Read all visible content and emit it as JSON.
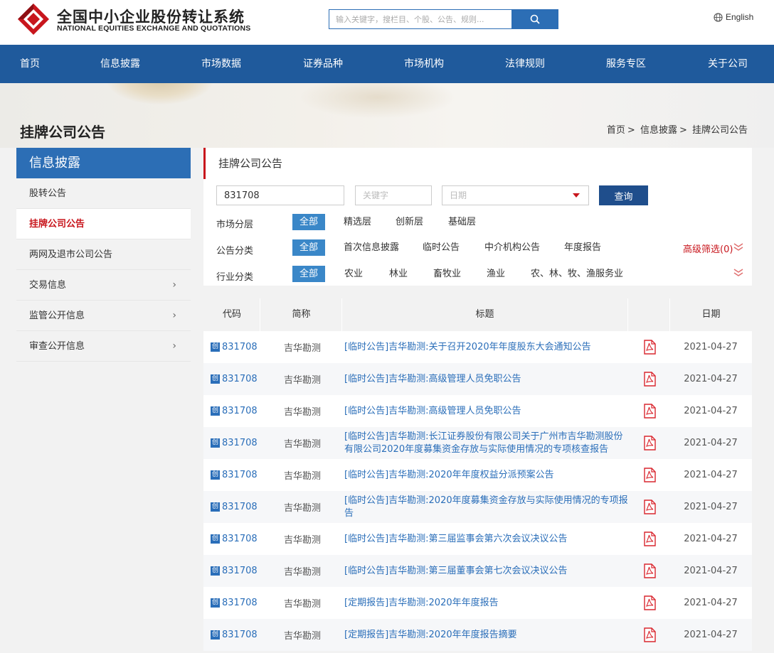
{
  "header": {
    "logo_cn": "全国中小企业股份转让系统",
    "logo_en": "NATIONAL EQUITIES EXCHANGE AND QUOTATIONS",
    "search_placeholder": "输入关键字，搜栏目、个股、公告、规则...",
    "lang": "English"
  },
  "nav": [
    "首页",
    "信息披露",
    "市场数据",
    "证券品种",
    "市场机构",
    "法律规则",
    "服务专区",
    "关于公司"
  ],
  "banner": {
    "page_title": "挂牌公司公告",
    "breadcrumb": [
      "首页",
      "信息披露",
      "挂牌公司公告"
    ]
  },
  "sidebar": {
    "title": "信息披露",
    "items": [
      {
        "label": "股转公告",
        "active": false,
        "expandable": false
      },
      {
        "label": "挂牌公司公告",
        "active": true,
        "expandable": false
      },
      {
        "label": "两网及退市公司公告",
        "active": false,
        "expandable": false
      },
      {
        "label": "交易信息",
        "active": false,
        "expandable": true
      },
      {
        "label": "监管公开信息",
        "active": false,
        "expandable": true
      },
      {
        "label": "审查公开信息",
        "active": false,
        "expandable": true
      }
    ]
  },
  "filter": {
    "title": "挂牌公司公告",
    "code_value": "831708",
    "keyword_placeholder": "关键字",
    "date_placeholder": "日期",
    "query_label": "查询",
    "market_label": "市场分层",
    "market_options": [
      "全部",
      "精选层",
      "创新层",
      "基础层"
    ],
    "category_label": "公告分类",
    "category_options": [
      "全部",
      "首次信息披露",
      "临时公告",
      "中介机构公告",
      "年度报告"
    ],
    "advanced_label": "高级筛选(0)",
    "industry_label": "行业分类",
    "industry_options": [
      "全部",
      "农业",
      "林业",
      "畜牧业",
      "渔业",
      "农、林、牧、渔服务业"
    ]
  },
  "table": {
    "headers": [
      "代码",
      "简称",
      "标题",
      "",
      "日期"
    ],
    "badge": "创",
    "rows": [
      {
        "code": "831708",
        "name": "吉华勘测",
        "title": "[临时公告]吉华勘测:关于召开2020年年度股东大会通知公告",
        "date": "2021-04-27"
      },
      {
        "code": "831708",
        "name": "吉华勘测",
        "title": "[临时公告]吉华勘测:高级管理人员免职公告",
        "date": "2021-04-27"
      },
      {
        "code": "831708",
        "name": "吉华勘测",
        "title": "[临时公告]吉华勘测:高级管理人员免职公告",
        "date": "2021-04-27"
      },
      {
        "code": "831708",
        "name": "吉华勘测",
        "title": "[临时公告]吉华勘测:长江证券股份有限公司关于广州市吉华勘测股份有限公司2020年度募集资金存放与实际使用情况的专项核查报告",
        "date": "2021-04-27"
      },
      {
        "code": "831708",
        "name": "吉华勘测",
        "title": "[临时公告]吉华勘测:2020年年度权益分派预案公告",
        "date": "2021-04-27"
      },
      {
        "code": "831708",
        "name": "吉华勘测",
        "title": "[临时公告]吉华勘测:2020年度募集资金存放与实际使用情况的专项报告",
        "date": "2021-04-27"
      },
      {
        "code": "831708",
        "name": "吉华勘测",
        "title": "[临时公告]吉华勘测:第三届监事会第六次会议决议公告",
        "date": "2021-04-27"
      },
      {
        "code": "831708",
        "name": "吉华勘测",
        "title": "[临时公告]吉华勘测:第三届董事会第七次会议决议公告",
        "date": "2021-04-27"
      },
      {
        "code": "831708",
        "name": "吉华勘测",
        "title": "[定期报告]吉华勘测:2020年年度报告",
        "date": "2021-04-27"
      },
      {
        "code": "831708",
        "name": "吉华勘测",
        "title": "[定期报告]吉华勘测:2020年年度报告摘要",
        "date": "2021-04-27"
      }
    ]
  },
  "colors": {
    "nav_blue": "#1f5a9c",
    "accent_blue": "#2c6eb5",
    "link_blue": "#2a6eb9",
    "accent_red": "#c8161d"
  }
}
